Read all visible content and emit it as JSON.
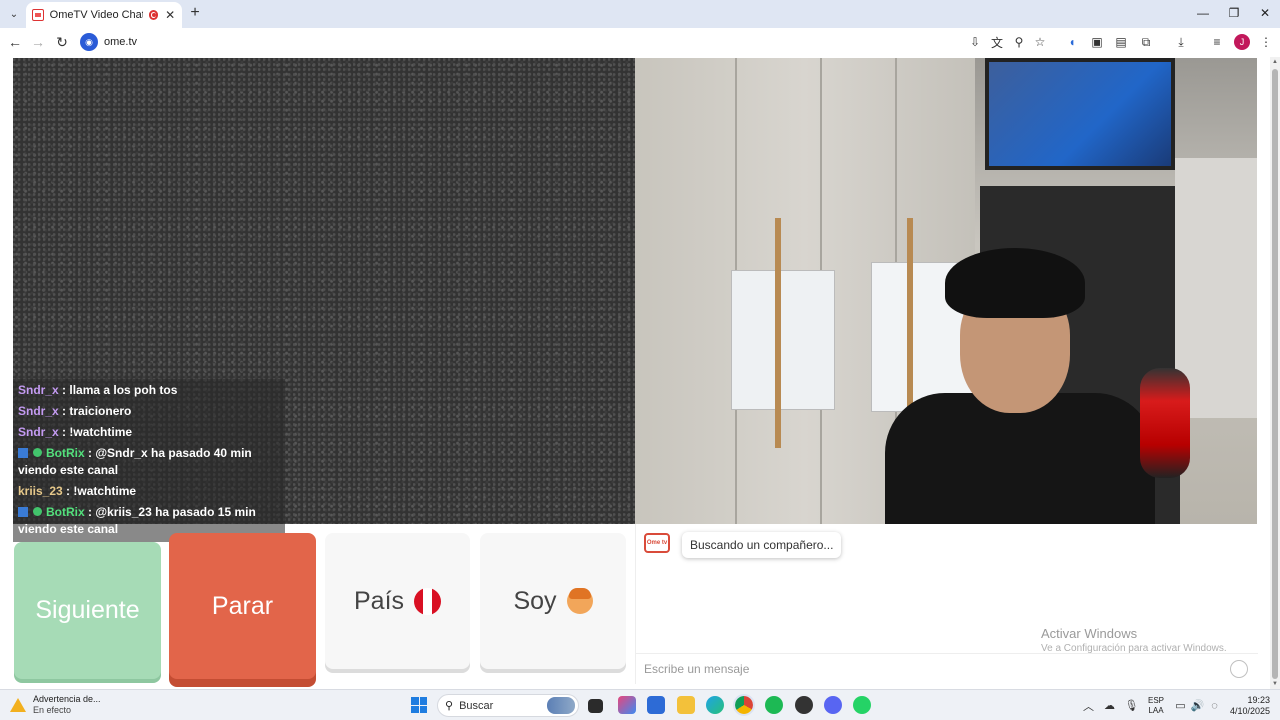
{
  "browser": {
    "tab_title": "OmeTV Video Chat — Ome",
    "new_tab_icon": "plus-icon",
    "url": "ome.tv",
    "profile_initial": "J"
  },
  "chat_messages": [
    {
      "user": "Sndr_x",
      "sep": " : ",
      "text": "llama a los poh tos",
      "type": "user"
    },
    {
      "user": "Sndr_x",
      "sep": " : ",
      "text": "traicionero",
      "type": "user"
    },
    {
      "user": "Sndr_x",
      "sep": " : ",
      "text": "!watchtime",
      "type": "user"
    },
    {
      "user": "BotRix",
      "sep": " : ",
      "text": "@Sndr_x ha pasado 40 min viendo este canal",
      "type": "bot"
    },
    {
      "user": "kriis_23",
      "sep": " : ",
      "text": "!watchtime",
      "type": "user2"
    },
    {
      "user": "BotRix",
      "sep": " : ",
      "text": "@kriis_23 ha pasado 15 min viendo este canal",
      "type": "bot"
    }
  ],
  "controls": {
    "next_label": "Siguiente",
    "stop_label": "Parar",
    "country_label": "País",
    "soy_label": "Soy"
  },
  "chat": {
    "logo_text": "Ome tv",
    "status": "Buscando un compañero...",
    "input_placeholder": "Escribe un mensaje"
  },
  "watermark": {
    "title": "Activar Windows",
    "subtitle": "Ve a Configuración para activar Windows."
  },
  "taskbar": {
    "warning_title": "Advertencia de...",
    "warning_sub": "En efecto",
    "search_label": "Buscar",
    "lang_top": "ESP",
    "lang_bottom": "LAA",
    "time": "19:23",
    "date": "4/10/2025"
  },
  "colors": {
    "next": "#a6dbb6",
    "stop": "#e2654a",
    "flag_red": "#d91023",
    "accent_blue": "#1f7de0"
  }
}
